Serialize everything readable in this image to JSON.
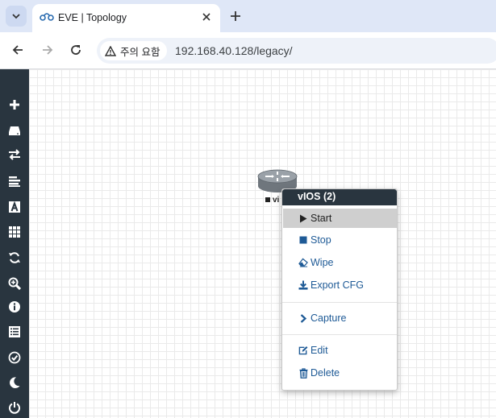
{
  "colors": {
    "sidebar_bg": "#29353f",
    "menu_link": "#1e5a96",
    "tabbar_bg": "#dfe7f7"
  },
  "browser": {
    "tab": {
      "title": "EVE | Topology",
      "icon": "eve-logo-icon"
    },
    "security_chip": "주의 요함",
    "url": "192.168.40.128/legacy/"
  },
  "sidebar": {
    "items": [
      {
        "name": "add-object-icon"
      },
      {
        "name": "nodes-icon"
      },
      {
        "name": "networks-icon"
      },
      {
        "name": "startup-configs-icon"
      },
      {
        "name": "text-icon"
      },
      {
        "name": "grid-icon"
      },
      {
        "name": "refresh-icon"
      },
      {
        "name": "zoom-icon"
      },
      {
        "name": "info-icon"
      },
      {
        "name": "lab-details-icon"
      },
      {
        "name": "status-icon"
      },
      {
        "name": "dark-mode-icon"
      },
      {
        "name": "power-icon"
      }
    ]
  },
  "node": {
    "label": "vi"
  },
  "context_menu": {
    "title": "vIOS (2)",
    "items": [
      {
        "label": "Start",
        "icon": "play-icon"
      },
      {
        "label": "Stop",
        "icon": "stop-icon"
      },
      {
        "label": "Wipe",
        "icon": "eraser-icon"
      },
      {
        "label": "Export CFG",
        "icon": "download-icon"
      },
      {
        "label": "Capture",
        "icon": "chevron-right-icon"
      },
      {
        "label": "Edit",
        "icon": "edit-icon"
      },
      {
        "label": "Delete",
        "icon": "trash-icon"
      }
    ]
  }
}
